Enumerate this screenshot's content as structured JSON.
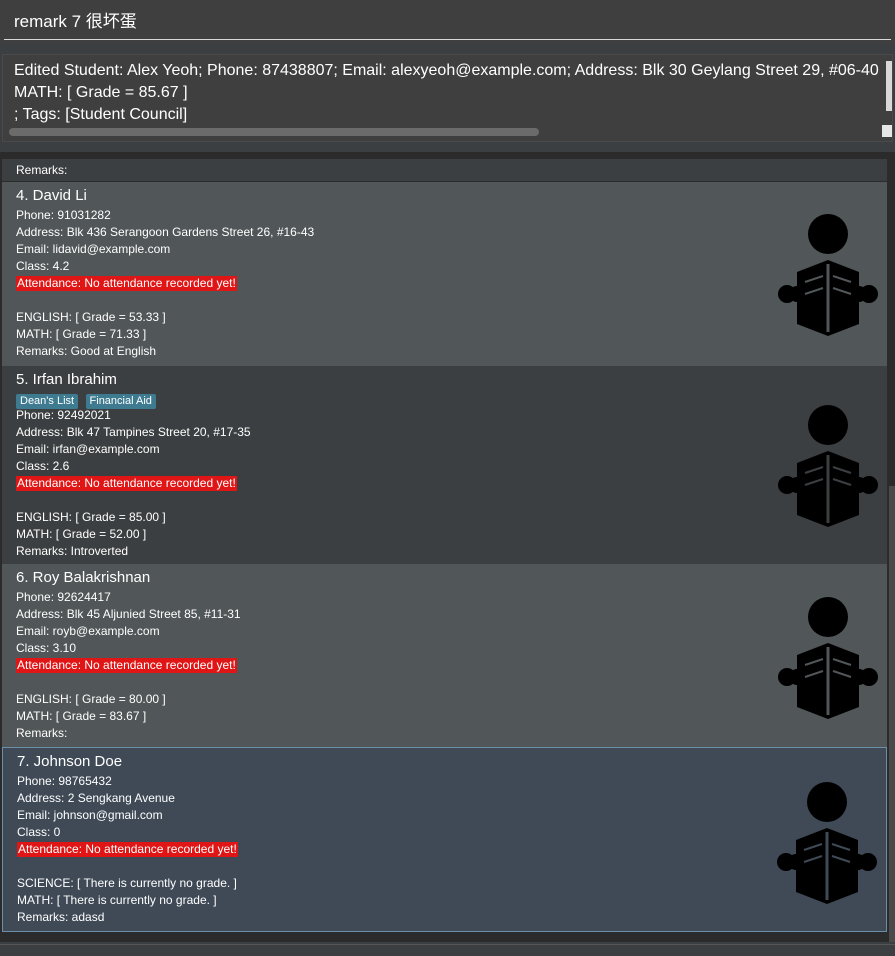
{
  "command_box": {
    "value": "remark 7 很坏蛋"
  },
  "result_box": {
    "lines": [
      "Edited Student: Alex Yeoh; Phone: 87438807; Email: alexyeoh@example.com; Address: Blk 30 Geylang Street 29, #06-40",
      "MATH: [ Grade = 85.67 ]",
      "; Tags: [Student Council]"
    ]
  },
  "list": {
    "header_remarks": "Remarks:",
    "cards": [
      {
        "name": "4. David Li",
        "tags": [],
        "phone": "Phone: 91031282",
        "address": "Address: Blk 436 Serangoon Gardens Street 26, #16-43",
        "email": "Email: lidavid@example.com",
        "class": "Class: 4.2",
        "attendance": "Attendance: No attendance recorded yet!",
        "subject1": "ENGLISH: [ Grade = 53.33 ]",
        "subject2": "MATH: [ Grade = 71.33 ]",
        "remarks": "Remarks: Good at English"
      },
      {
        "name": "5. Irfan Ibrahim",
        "tags": [
          "Dean's List",
          "Financial Aid"
        ],
        "phone": "Phone: 92492021",
        "address": "Address: Blk 47 Tampines Street 20, #17-35",
        "email": "Email: irfan@example.com",
        "class": "Class: 2.6",
        "attendance": "Attendance: No attendance recorded yet!",
        "subject1": "ENGLISH: [ Grade = 85.00 ]",
        "subject2": "MATH: [ Grade = 52.00 ]",
        "remarks": "Remarks: Introverted"
      },
      {
        "name": "6. Roy Balakrishnan",
        "tags": [],
        "phone": "Phone: 92624417",
        "address": "Address: Blk 45 Aljunied Street 85, #11-31",
        "email": "Email: royb@example.com",
        "class": "Class: 3.10",
        "attendance": "Attendance: No attendance recorded yet!",
        "subject1": "ENGLISH: [ Grade = 80.00 ]",
        "subject2": "MATH: [ Grade = 83.67 ]",
        "remarks": "Remarks:"
      },
      {
        "name": "7. Johnson Doe",
        "tags": [],
        "phone": "Phone: 98765432",
        "address": "Address: 2 Sengkang Avenue",
        "email": "Email: johnson@gmail.com",
        "class": "Class: 0",
        "attendance": "Attendance: No attendance recorded yet!",
        "subject1": "SCIENCE: [ There is currently no grade. ]",
        "subject2": "MATH: [ There is currently no grade. ]",
        "remarks": "Remarks: adasd"
      }
    ],
    "avatar_icon": "person-reading-book-icon"
  },
  "status_bar": {
    "text": ""
  },
  "colors": {
    "background": "#3c3f41",
    "card_even": "#515658",
    "card_odd": "#3c3f41",
    "attendance_highlight": "#e01515",
    "tag": "#3e7b91"
  }
}
